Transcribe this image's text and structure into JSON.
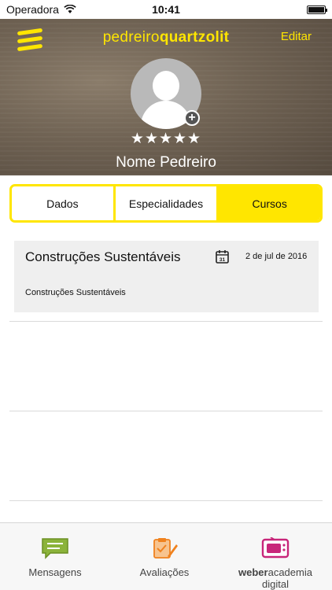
{
  "status_bar": {
    "carrier": "Operadora",
    "time": "10:41",
    "battery_level": 1.0
  },
  "header": {
    "brand_regular": "pedreiro",
    "brand_bold": "quartzolit",
    "edit_label": "Editar",
    "stars_count": 5,
    "stars": "★★★★★",
    "avatar_add_symbol": "+",
    "profile_name": "Nome Pedreiro"
  },
  "tabs": [
    {
      "label": "Dados",
      "active": false
    },
    {
      "label": "Especialidades",
      "active": false
    },
    {
      "label": "Cursos",
      "active": true
    }
  ],
  "courses": [
    {
      "title": "Construções Sustentáveis",
      "calendar_icon_day": "31",
      "date": "2 de jul de 2016",
      "description": "Construções Sustentáveis"
    }
  ],
  "tab_bar": {
    "items": [
      {
        "label": "Mensagens",
        "icon": "message-icon"
      },
      {
        "label": "Avaliações",
        "icon": "evaluation-icon"
      },
      {
        "label_bold": "weber",
        "label_regular": "academia",
        "label_line2": "digital",
        "icon": "academy-tv-icon"
      }
    ]
  },
  "colors": {
    "accent": "#ffe600",
    "header_bg": "#6f6253",
    "tab_message": "#8bb33a",
    "tab_evaluation": "#f0821e",
    "tab_academy": "#c8267a"
  }
}
